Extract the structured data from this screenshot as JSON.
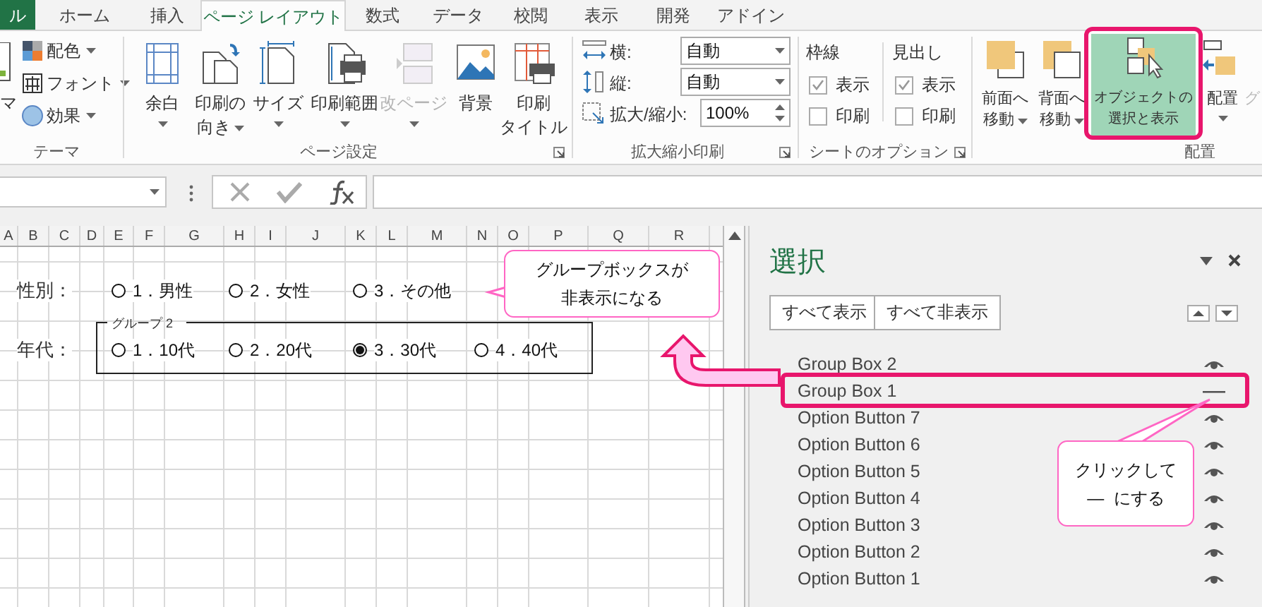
{
  "ribbon_tabs": [
    {
      "label": "ル",
      "selected": false,
      "kind": "file"
    },
    {
      "label": "ホーム",
      "selected": false
    },
    {
      "label": "挿入",
      "selected": false
    },
    {
      "label": "ページ レイアウト",
      "selected": true
    },
    {
      "label": "数式",
      "selected": false
    },
    {
      "label": "データ",
      "selected": false
    },
    {
      "label": "校閲",
      "selected": false
    },
    {
      "label": "表示",
      "selected": false
    },
    {
      "label": "開発",
      "selected": false
    },
    {
      "label": "アドイン",
      "selected": false
    }
  ],
  "theme_group": {
    "label": "テーマ",
    "cut_button": "マ",
    "items": [
      "配色",
      "フォント",
      "効果"
    ]
  },
  "page_setup_group": {
    "label": "ページ設定",
    "buttons": [
      {
        "lines": [
          "余白"
        ],
        "dropdown": true,
        "disabled": false
      },
      {
        "lines": [
          "印刷の",
          "向き"
        ],
        "dropdown": true,
        "disabled": false
      },
      {
        "lines": [
          "サイズ"
        ],
        "dropdown": true,
        "disabled": false
      },
      {
        "lines": [
          "印刷範囲"
        ],
        "dropdown": true,
        "disabled": false
      },
      {
        "lines": [
          "改ページ"
        ],
        "dropdown": true,
        "disabled": true
      },
      {
        "lines": [
          "背景"
        ],
        "dropdown": false,
        "disabled": false
      },
      {
        "lines": [
          "印刷",
          "タイトル"
        ],
        "dropdown": false,
        "disabled": false
      }
    ]
  },
  "scale_group": {
    "label": "拡大縮小印刷",
    "rows": [
      {
        "label": "横:",
        "value": "自動",
        "kind": "dropdown"
      },
      {
        "label": "縦:",
        "value": "自動",
        "kind": "dropdown"
      },
      {
        "label": "拡大/縮小:",
        "value": "100%",
        "kind": "spinner"
      }
    ]
  },
  "sheet_options_group": {
    "label": "シートのオプション",
    "columns": [
      {
        "heading": "枠線",
        "options": [
          {
            "label": "表示",
            "checked": true
          },
          {
            "label": "印刷",
            "checked": false
          }
        ]
      },
      {
        "heading": "見出し",
        "options": [
          {
            "label": "表示",
            "checked": true
          },
          {
            "label": "印刷",
            "checked": false
          }
        ]
      }
    ]
  },
  "arrange_group": {
    "label": "配置",
    "buttons": [
      {
        "lines": [
          "前面へ",
          "移動"
        ],
        "selected": false
      },
      {
        "lines": [
          "背面へ",
          "移動"
        ],
        "selected": false
      },
      {
        "lines": [
          "オブジェクトの",
          "選択と表示"
        ],
        "selected": true
      },
      {
        "lines": [
          "配置"
        ],
        "selected": false
      },
      {
        "lines": [
          "グ"
        ],
        "selected": false
      }
    ]
  },
  "sheet": {
    "columns": [
      "A",
      "B",
      "C",
      "D",
      "E",
      "F",
      "G",
      "H",
      "I",
      "J",
      "K",
      "L",
      "M",
      "N",
      "O",
      "P",
      "Q",
      "R"
    ],
    "rows": [
      {
        "label": "性別：",
        "options": [
          {
            "text": "1．男性",
            "selected": false
          },
          {
            "text": "2．女性",
            "selected": false
          },
          {
            "text": "3．その他",
            "selected": false
          }
        ]
      },
      {
        "label": "年代：",
        "group_caption": "グループ 2",
        "options": [
          {
            "text": "1．10代",
            "selected": false
          },
          {
            "text": "2．20代",
            "selected": false
          },
          {
            "text": "3．30代",
            "selected": true
          },
          {
            "text": "4．40代",
            "selected": false
          }
        ]
      }
    ]
  },
  "selection_pane": {
    "title": "選択",
    "buttons": [
      "すべて表示",
      "すべて非表示"
    ],
    "items": [
      {
        "name": "Group Box 2",
        "visible": true,
        "highlighted": false
      },
      {
        "name": "Group Box 1",
        "visible": false,
        "highlighted": true
      },
      {
        "name": "Option Button 7",
        "visible": true,
        "highlighted": false
      },
      {
        "name": "Option Button 6",
        "visible": true,
        "highlighted": false
      },
      {
        "name": "Option Button 5",
        "visible": true,
        "highlighted": false
      },
      {
        "name": "Option Button 4",
        "visible": true,
        "highlighted": false
      },
      {
        "name": "Option Button 3",
        "visible": true,
        "highlighted": false
      },
      {
        "name": "Option Button 2",
        "visible": true,
        "highlighted": false
      },
      {
        "name": "Option Button 1",
        "visible": true,
        "highlighted": false
      }
    ]
  },
  "callouts": [
    {
      "lines": [
        "グループボックスが",
        "非表示になる"
      ]
    },
    {
      "lines": [
        "クリックして",
        "—  にする"
      ]
    }
  ]
}
